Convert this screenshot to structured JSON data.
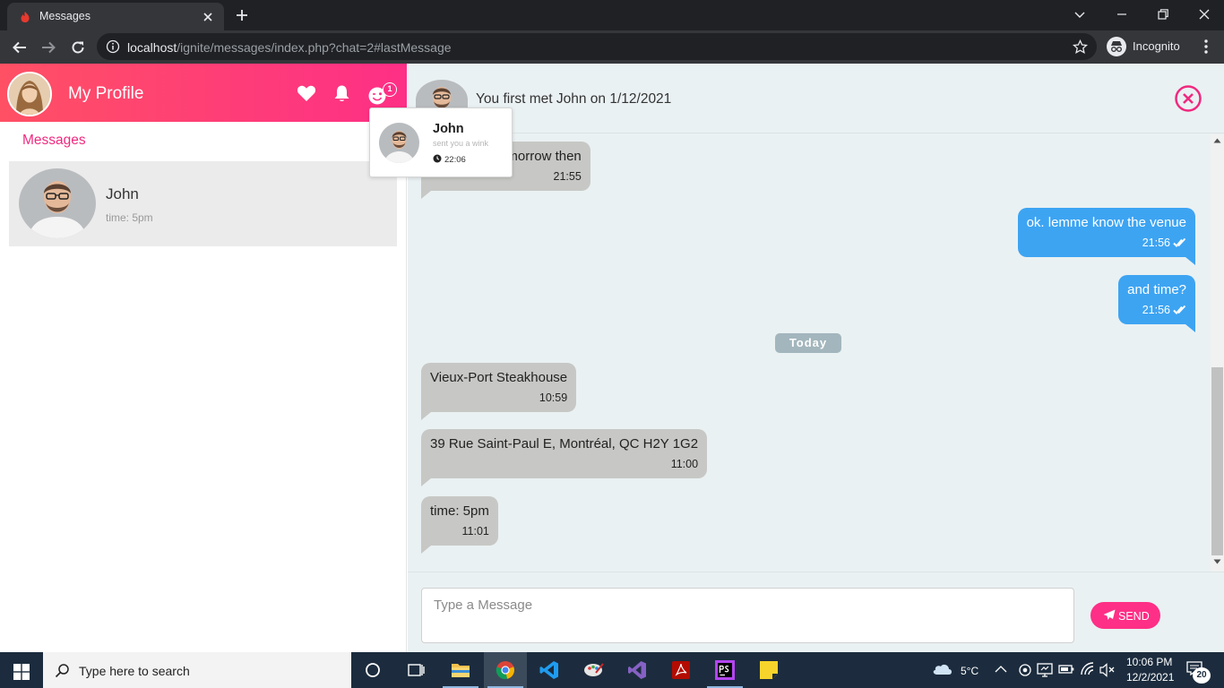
{
  "browser": {
    "tab_title": "Messages",
    "url_host": "localhost",
    "url_path": "/ignite/messages/index.php?chat=2#lastMessage",
    "incognito_label": "Incognito"
  },
  "sidebar": {
    "profile_name": "My Profile",
    "heading": "Messages",
    "chats": [
      {
        "name": "John",
        "subtitle": "time: 5pm"
      }
    ]
  },
  "notification": {
    "badge_count": "1",
    "popup": {
      "name": "John",
      "text": "sent you a wink",
      "time": "22:06"
    }
  },
  "chat": {
    "header_text": "You first met John on 1/12/2021",
    "messages": [
      {
        "direction": "in",
        "text": "Let's meet tomorrow then",
        "time": "21:55"
      },
      {
        "direction": "out",
        "text": "ok. lemme know the venue",
        "time": "21:56"
      },
      {
        "direction": "out",
        "text": "and time?",
        "time": "21:56"
      },
      {
        "direction": "in",
        "text": "Vieux-Port Steakhouse",
        "time": "10:59"
      },
      {
        "direction": "in",
        "text": "39 Rue Saint-Paul E, Montréal, QC H2Y 1G2",
        "time": "11:00"
      },
      {
        "direction": "in",
        "text": "time: 5pm",
        "time": "11:01"
      }
    ],
    "date_divider": "Today",
    "input_placeholder": "Type a Message",
    "send_label": "SEND"
  },
  "taskbar": {
    "search_placeholder": "Type here to search",
    "weather": "5°C",
    "time": "10:06 PM",
    "date": "12/2/2021",
    "notifications": "20"
  },
  "colors": {
    "brand_pink": "#fe2f86",
    "brand_red": "#ff5064",
    "outgoing_bubble": "#3da4f2",
    "incoming_bubble": "#c7c8c5",
    "chat_background": "#eaf1f3"
  }
}
